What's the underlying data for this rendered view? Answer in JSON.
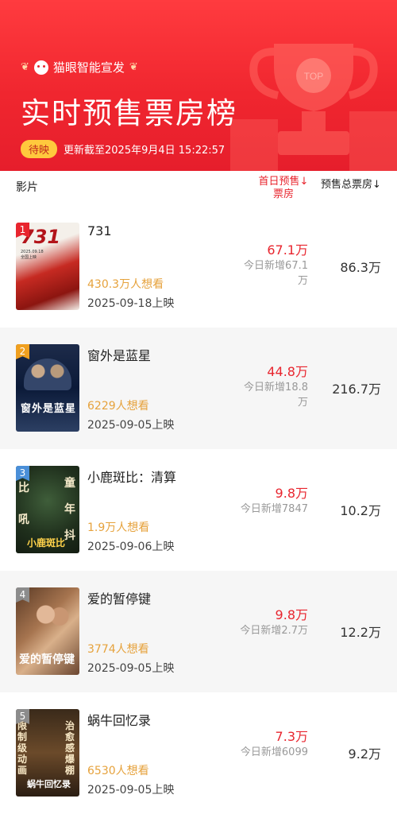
{
  "header": {
    "brand": "猫眼智能宣发",
    "title": "实时预售票房榜",
    "badge": "待映",
    "update_text": "更新截至2025年9月4日 15:22:57",
    "trophy_text": "TOP"
  },
  "columns": {
    "film": "影片",
    "first_day_line1": "首日预售↓",
    "first_day_line2": "票房",
    "total": "预售总票房↓"
  },
  "movies": [
    {
      "rank": "1",
      "title": "731",
      "want": "430.3万人想看",
      "release": "2025-09-18上映",
      "first_day": "67.1万",
      "today_new_line1": "今日新增67.1",
      "today_new_line2": "万",
      "total": "86.3万",
      "poster_text": "731",
      "poster_sub": "2025.09.18 全国上映",
      "rank_color": "#e8252e"
    },
    {
      "rank": "2",
      "title": "窗外是蓝星",
      "want": "6229人想看",
      "release": "2025-09-05上映",
      "first_day": "44.8万",
      "today_new_line1": "今日新增18.8",
      "today_new_line2": "万",
      "total": "216.7万",
      "poster_text": "窗外是蓝星",
      "rank_color": "#f0a020"
    },
    {
      "rank": "3",
      "title": "小鹿斑比：清算",
      "want": "1.9万人想看",
      "release": "2025-09-06上映",
      "first_day": "9.8万",
      "today_new_line1": "今日新增7847",
      "today_new_line2": "",
      "total": "10.2万",
      "poster_text": "小鹿斑比",
      "poster_side_left": "比 吼",
      "poster_side_right": "童 年 抖",
      "rank_color": "#4a8fd8"
    },
    {
      "rank": "4",
      "title": "爱的暂停键",
      "want": "3774人想看",
      "release": "2025-09-05上映",
      "first_day": "9.8万",
      "today_new_line1": "今日新增2.7万",
      "today_new_line2": "",
      "total": "12.2万",
      "poster_text": "爱的暂停键",
      "rank_color": "#8c8c8c"
    },
    {
      "rank": "5",
      "title": "蜗牛回忆录",
      "want": "6530人想看",
      "release": "2025-09-05上映",
      "first_day": "7.3万",
      "today_new_line1": "今日新增6099",
      "today_new_line2": "",
      "total": "9.2万",
      "poster_text": "蜗牛回忆录",
      "poster_side_left": "限制级动画",
      "poster_side_right": "治愈感爆棚",
      "rank_color": "#8c8c8c"
    }
  ]
}
